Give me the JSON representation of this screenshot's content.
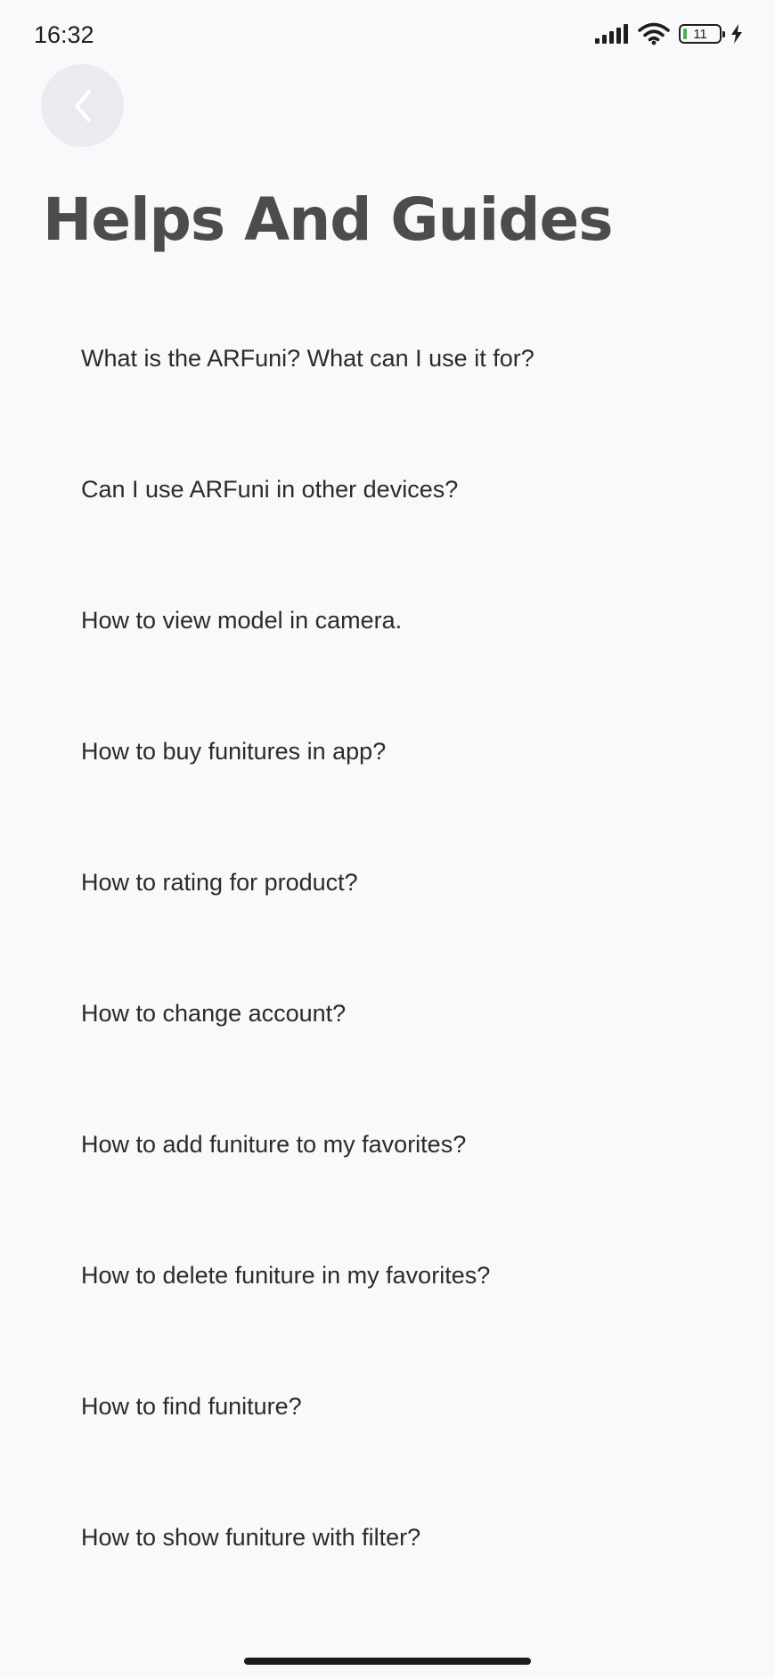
{
  "status_bar": {
    "time": "16:32",
    "battery_level": "11",
    "icons": [
      "signal-icon",
      "wifi-icon",
      "battery-icon",
      "charging-icon"
    ]
  },
  "header": {
    "back_icon": "chevron-left-icon",
    "title": "Helps And Guides"
  },
  "help_items": [
    {
      "label": "What is the ARFuni?  What can I use it for?"
    },
    {
      "label": "Can I use ARFuni in other devices?"
    },
    {
      "label": "How to view model in camera."
    },
    {
      "label": "How to buy funitures in app?"
    },
    {
      "label": "How to rating for product?"
    },
    {
      "label": "How to change account?"
    },
    {
      "label": "How to add funiture to my favorites?"
    },
    {
      "label": "How to delete funiture in my favorites?"
    },
    {
      "label": "How to find funiture?"
    },
    {
      "label": "How to show funiture with filter?"
    }
  ],
  "colors": {
    "background": "#f8f9fb",
    "title": "#4c4c4c",
    "text": "#2b2b2b",
    "back_button_bg": "#eaebef",
    "battery_fill": "#4caf50"
  }
}
